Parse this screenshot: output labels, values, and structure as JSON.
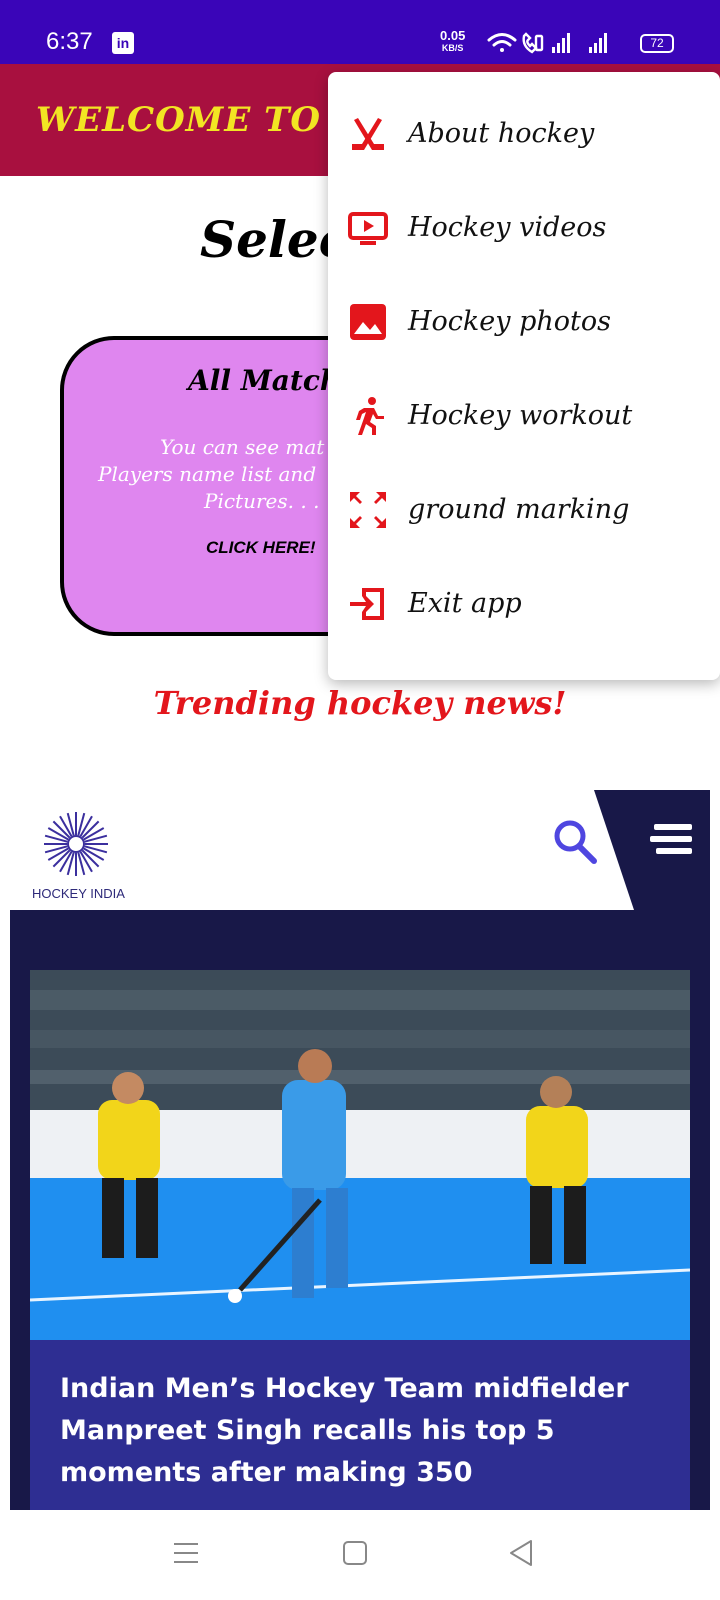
{
  "status_bar": {
    "time": "6:37",
    "app_badge": "in",
    "net_speed_value": "0.05",
    "net_speed_unit": "KB/S",
    "battery": "72"
  },
  "app_bar": {
    "title": "WELCOME TO STI",
    "color": "#a8103f",
    "title_color": "#f2e523"
  },
  "main": {
    "heading": "Select",
    "card": {
      "title": "All Matchs.",
      "desc_line1": "You can see mat",
      "desc_line2": "Players name list and",
      "desc_line3": "Pictures. . .",
      "cta": "CLICK HERE!"
    },
    "trending": "Trending hockey news!"
  },
  "web_view": {
    "logo_text": "HOCKEY INDIA",
    "search_icon": "search-icon",
    "menu_icon": "hamburger-menu-icon",
    "news_title": "Indian Men’s Hockey Team midfielder Manpreet Singh recalls his top 5 moments after making 350"
  },
  "popup_menu": {
    "items": [
      {
        "label": "About hockey",
        "icon": "hockey-sticks-icon"
      },
      {
        "label": "Hockey videos",
        "icon": "video-player-icon"
      },
      {
        "label": "Hockey photos",
        "icon": "image-icon"
      },
      {
        "label": "Hockey workout",
        "icon": "running-person-icon"
      },
      {
        "label": "ground marking",
        "icon": "expand-arrows-icon"
      },
      {
        "label": "Exit app",
        "icon": "exit-icon"
      }
    ],
    "icon_color": "#e3161c"
  }
}
